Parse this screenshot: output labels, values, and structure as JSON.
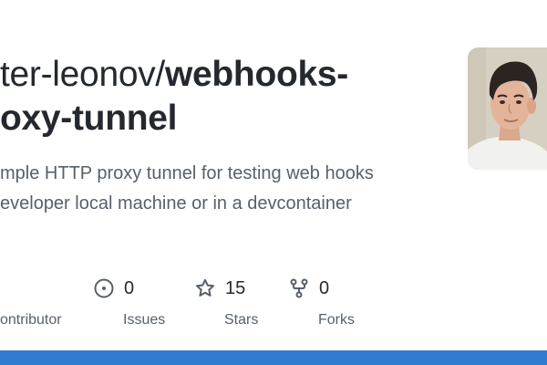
{
  "repo": {
    "owner_partial": "ter-leonov/",
    "name_line1": "webhooks-",
    "name_line2": "oxy-tunnel"
  },
  "description": {
    "line1": "mple HTTP proxy tunnel for testing web hooks",
    "line2": "eveloper local machine or in a devcontainer"
  },
  "stats": {
    "contributors": {
      "label": "ontributor",
      "icon": "people-icon"
    },
    "issues": {
      "count": "0",
      "label": "Issues",
      "icon": "issue-icon"
    },
    "stars": {
      "count": "15",
      "label": "Stars",
      "icon": "star-icon"
    },
    "forks": {
      "count": "0",
      "label": "Forks",
      "icon": "fork-icon"
    }
  },
  "colors": {
    "text": "#24292f",
    "muted": "#57606a",
    "bottom_bar": "#2f7bd0"
  }
}
